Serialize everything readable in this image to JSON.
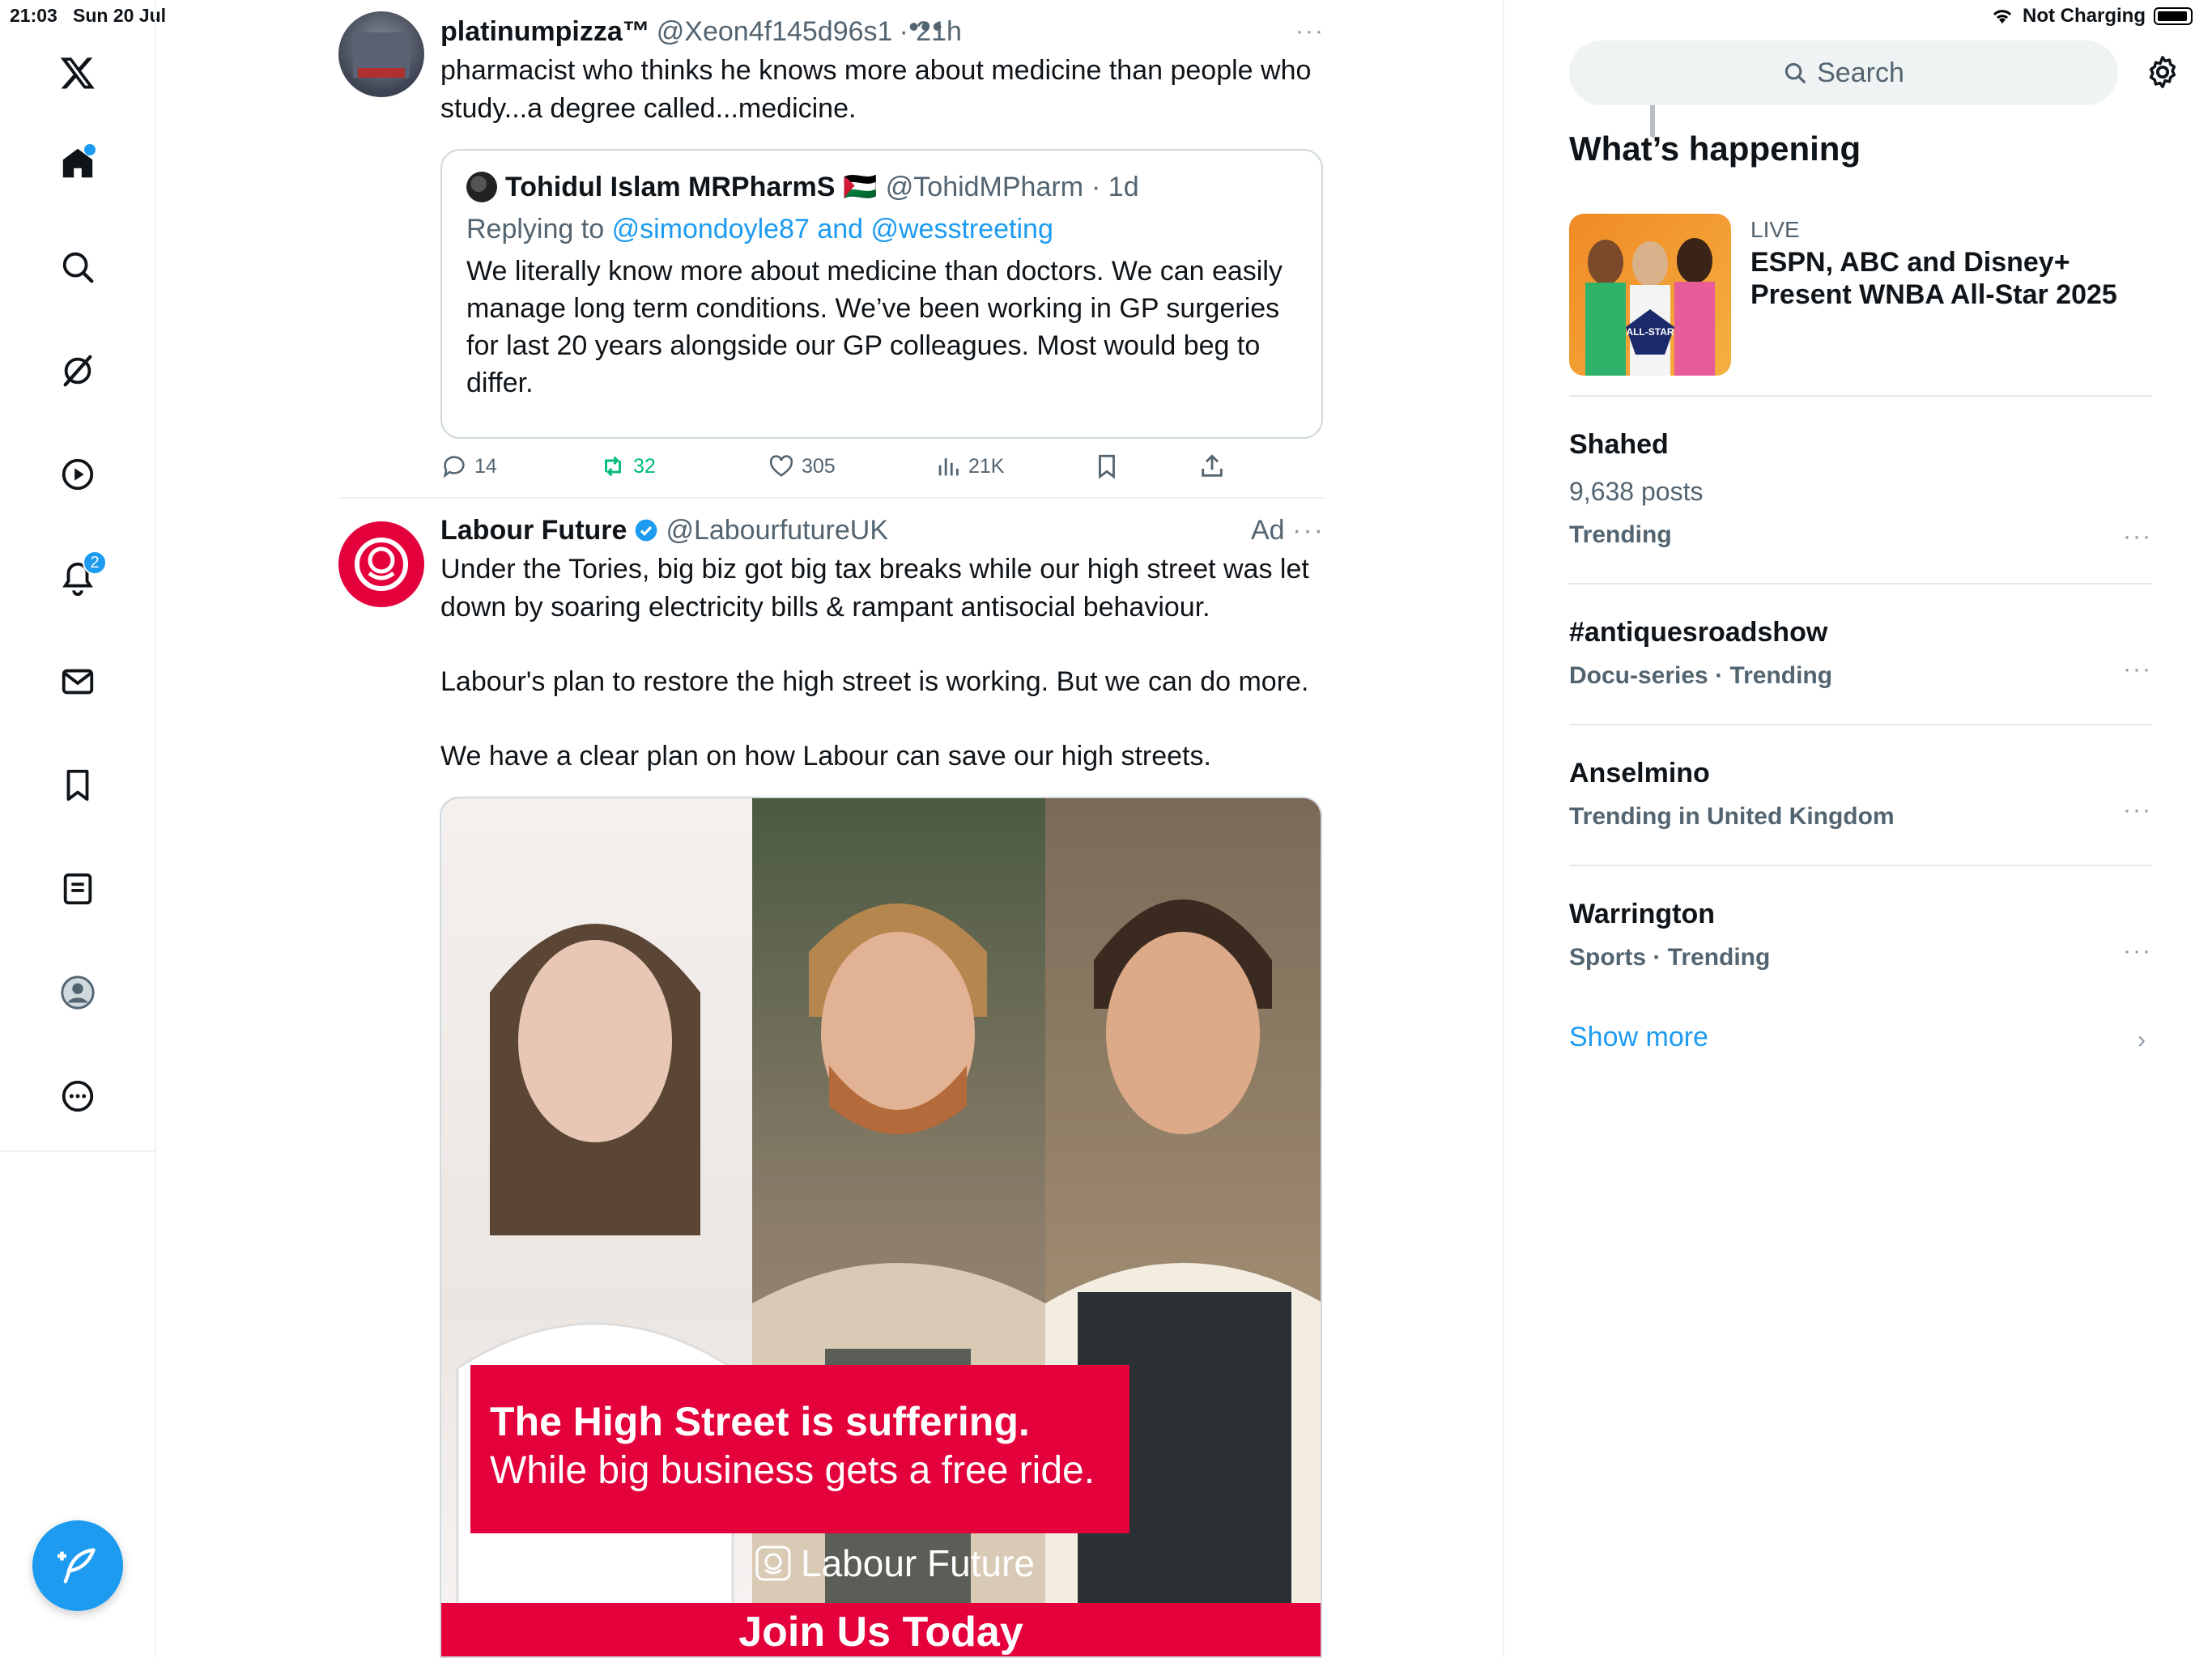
{
  "status_bar": {
    "time": "21:03",
    "date": "Sun 20 Jul",
    "charging": "Not Charging"
  },
  "nav": {
    "notifications_badge": "2",
    "items": [
      "x-logo",
      "home",
      "explore",
      "grok",
      "video",
      "notifications",
      "messages",
      "bookmarks",
      "lists",
      "profile",
      "more"
    ]
  },
  "tweet1": {
    "name": "platinumpizza™",
    "handle": "@Xeon4f145d96s1",
    "time": "· 21h",
    "text": "pharmacist who thinks he knows more about medicine than people who study...a degree called...medicine.",
    "quote": {
      "name": "Tohidul Islam MRPharmS",
      "flag": "🇵🇸",
      "handle": "@TohidMPharm",
      "time": "· 1d",
      "replying_prefix": "Replying to",
      "replying_to": "@simondoyle87 and @wesstreeting",
      "text": "We literally know more about medicine than doctors. We can easily manage long term conditions. We’ve been working in GP surgeries for last 20 years alongside our GP colleagues. Most would beg to differ."
    },
    "actions": {
      "replies": "14",
      "reposts": "32",
      "likes": "305",
      "views": "21K"
    }
  },
  "tweet2": {
    "name": "Labour Future",
    "handle": "@LabourfutureUK",
    "ad_label": "Ad",
    "text_p1": "Under the Tories, big biz got big tax breaks while our high street was let down by soaring electricity bills & rampant antisocial behaviour.",
    "text_p2": "Labour's plan to restore the high street is working. But we can do more.",
    "text_p3": "We have a clear plan on how Labour can save our high streets.",
    "image": {
      "headline": "The High Street is suffering.",
      "subline": "While big business gets a free ride.",
      "brand": "Labour Future",
      "cta": "Join Us Today"
    }
  },
  "sidebar": {
    "search_placeholder": "Search",
    "heading": "What’s happening",
    "live": {
      "label": "LIVE",
      "title": "ESPN, ABC and Disney+ Present WNBA All-Star 2025"
    },
    "trends": [
      {
        "title": "Shahed",
        "sub": "9,638 posts",
        "meta": "Trending"
      },
      {
        "title": "#antiquesroadshow",
        "meta": "Docu-series · Trending"
      },
      {
        "title": "Anselmino",
        "meta": "Trending in United Kingdom"
      },
      {
        "title": "Warrington",
        "meta": "Sports · Trending"
      }
    ],
    "show_more": "Show more"
  },
  "colors": {
    "accent": "#1d9bf0",
    "repost": "#00ba7c",
    "labour_red": "#e4003b",
    "text": "#0f1419",
    "muted": "#536471"
  }
}
